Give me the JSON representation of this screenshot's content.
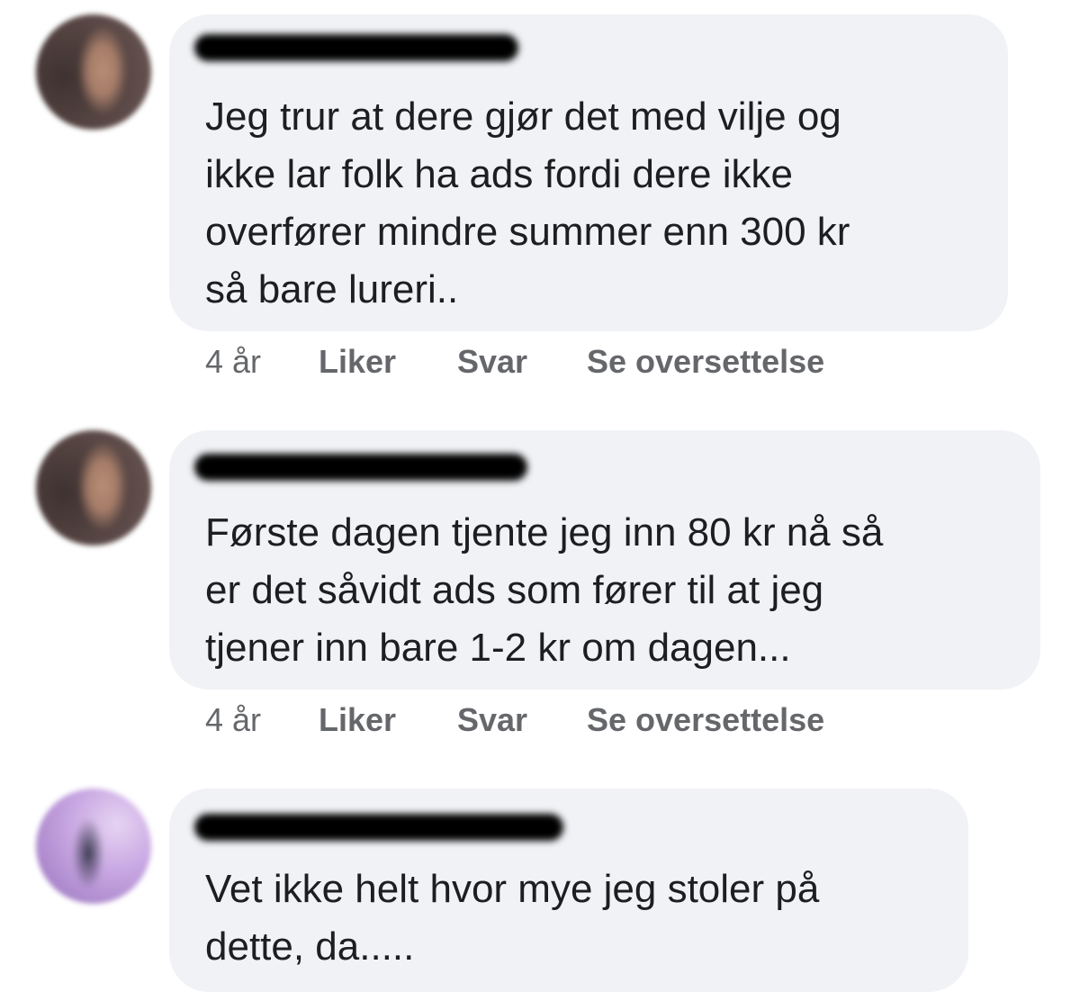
{
  "comments": [
    {
      "text": "Jeg trur at dere gjør det med vilje og\nikke lar folk ha ads fordi dere ikke\noverfører mindre summer enn 300 kr\nså bare lureri..",
      "time": "4 år",
      "like": "Liker",
      "reply": "Svar",
      "translate": "Se oversettelse"
    },
    {
      "text": "Første dagen tjente jeg inn 80 kr nå så\ner det såvidt ads som fører til at jeg\ntjener inn bare 1-2 kr om dagen...",
      "time": "4 år",
      "like": "Liker",
      "reply": "Svar",
      "translate": "Se oversettelse"
    },
    {
      "text": "Vet ikke helt hvor mye jeg stoler på\ndette, da....."
    }
  ],
  "colors": {
    "bubble": "#f0f2f5",
    "text": "#1c1e21",
    "meta": "#65676b"
  }
}
